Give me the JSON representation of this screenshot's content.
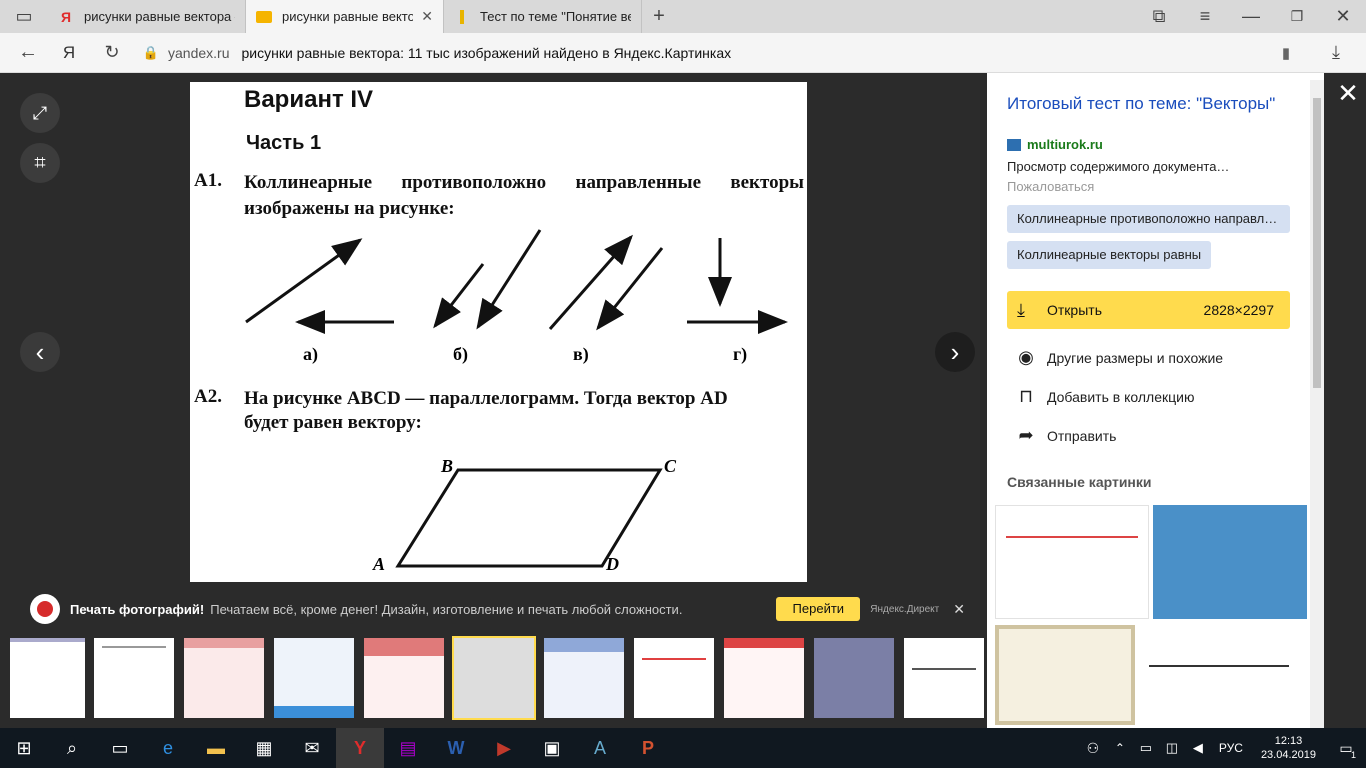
{
  "tabs": [
    {
      "label": "рисунки равные вектора –",
      "favicon": "Я"
    },
    {
      "label": "рисунки равные вектор",
      "favicon": "img"
    },
    {
      "label": "Тест по теме \"Понятие век",
      "favicon": "doc"
    }
  ],
  "address": {
    "domain": "yandex.ru",
    "page_title": "рисунки равные вектора: 11 тыс изображений найдено в Яндекс.Картинках"
  },
  "doc": {
    "heading": "Вариант IV",
    "part": "Часть 1",
    "a1_num": "А1.",
    "a1_text": "Коллинеарные противоположно направленные векторы изображены на рисунке:",
    "a1_labels": [
      "а)",
      "б)",
      "в)",
      "г)"
    ],
    "a2_num": "А2.",
    "a2_text1": "На рисунке ABCD — параллелограмм. Тогда вектор AD",
    "a2_text2": "будет равен вектору:",
    "points": [
      "B",
      "C",
      "A",
      "D"
    ]
  },
  "panel": {
    "title": "Итоговый тест по теме: \"Векторы\"",
    "source": "multiurok.ru",
    "desc": "Просмотр содержимого документа…",
    "complain": "Пожаловаться",
    "chips": [
      "Коллинеарные противоположно направл…",
      "Коллинеарные векторы равны"
    ],
    "open_label": "Открыть",
    "open_size": "2828×2297",
    "actions": [
      "Другие размеры и похожие",
      "Добавить в коллекцию",
      "Отправить"
    ],
    "related_title": "Связанные картинки"
  },
  "ad": {
    "title": "Печать фотографий!",
    "text": "Печатаем всё, кроме денег! Дизайн, изготовление и печать любой сложности.",
    "button": "Перейти",
    "source": "Яндекс.Директ"
  },
  "taskbar": {
    "lang": "РУС",
    "time": "12:13",
    "date": "23.04.2019",
    "notif": "1"
  },
  "colors": {
    "accent": "#ffdb4d",
    "link": "#1a4dbd",
    "chip": "#d5e0f2"
  }
}
